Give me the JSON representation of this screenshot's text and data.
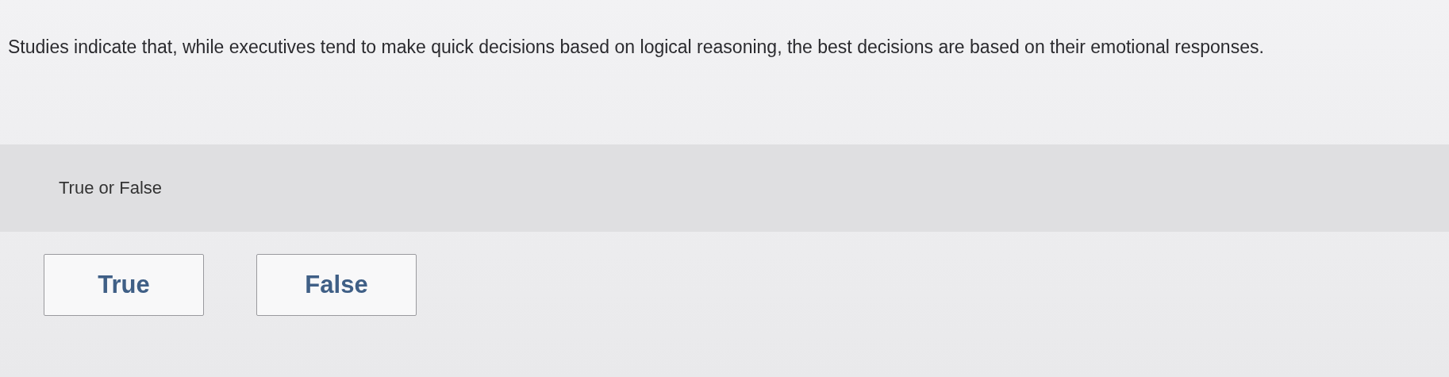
{
  "question": {
    "text": "Studies indicate that, while executives tend to make quick decisions based on logical reasoning, the best decisions are based on their emotional responses."
  },
  "prompt": {
    "label": "True or False"
  },
  "choices": [
    {
      "label": "True"
    },
    {
      "label": "False"
    }
  ]
}
